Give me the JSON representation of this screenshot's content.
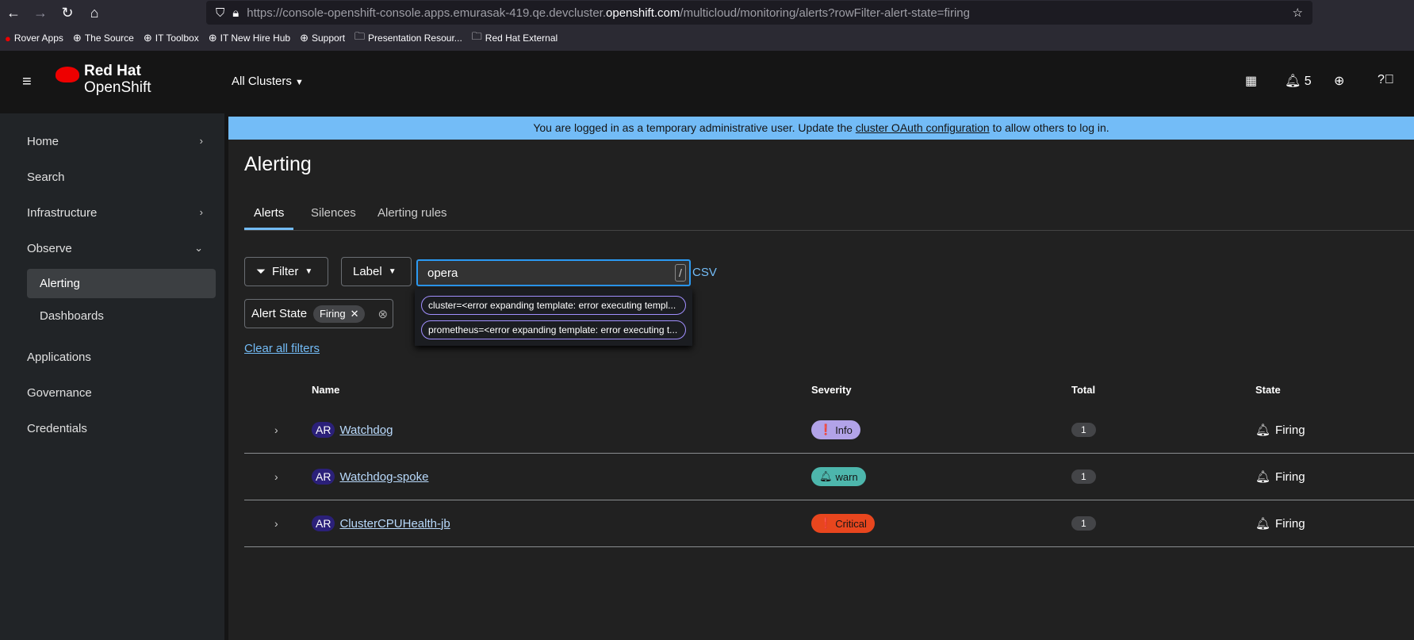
{
  "browser": {
    "url_prefix": "https://console-openshift-console.apps.emurasak-419.qe.devcluster.",
    "url_domain": "openshift.com",
    "url_suffix": "/multicloud/monitoring/alerts?rowFilter-alert-state=firing",
    "bookmarks": [
      "Rover Apps",
      "The Source",
      "IT Toolbox",
      "IT New Hire Hub",
      "Support",
      "Presentation Resour...",
      "Red Hat External"
    ]
  },
  "masthead": {
    "brand1": "Red Hat",
    "brand2": "OpenShift",
    "cluster_selector": "All Clusters",
    "notifications_count": "5"
  },
  "sidebar": {
    "items": [
      {
        "label": "Home"
      },
      {
        "label": "Search"
      },
      {
        "label": "Infrastructure"
      },
      {
        "label": "Observe"
      },
      {
        "label": "Alerting"
      },
      {
        "label": "Dashboards"
      },
      {
        "label": "Applications"
      },
      {
        "label": "Governance"
      },
      {
        "label": "Credentials"
      }
    ]
  },
  "banner": {
    "before": "You are logged in as a temporary administrative user. Update the ",
    "link": "cluster OAuth configuration",
    "after": " to allow others to log in."
  },
  "page": {
    "title": "Alerting",
    "tabs": [
      "Alerts",
      "Silences",
      "Alerting rules"
    ]
  },
  "filters": {
    "filter_label": "Filter",
    "label_label": "Label",
    "search_value": "opera",
    "slash": "/",
    "csv": "CSV",
    "suggestions": [
      "cluster=<error expanding template: error executing templ...",
      "prometheus=<error expanding template: error executing t..."
    ],
    "chip_group": "Alert State",
    "chip": "Firing",
    "clear_all": "Clear all filters"
  },
  "table": {
    "headers": [
      "Name",
      "Severity",
      "Total",
      "State"
    ],
    "rows": [
      {
        "badge": "AR",
        "name": "Watchdog",
        "severity": "Info",
        "severity_color": "#b2a3e8",
        "total": "1",
        "state": "Firing"
      },
      {
        "badge": "AR",
        "name": "Watchdog-spoke",
        "severity": "warn",
        "severity_color": "#4db6ac",
        "total": "1",
        "state": "Firing"
      },
      {
        "badge": "AR",
        "name": "ClusterCPUHealth-jb",
        "severity": "Critical",
        "severity_color": "#e8461e",
        "total": "1",
        "state": "Firing"
      }
    ]
  }
}
